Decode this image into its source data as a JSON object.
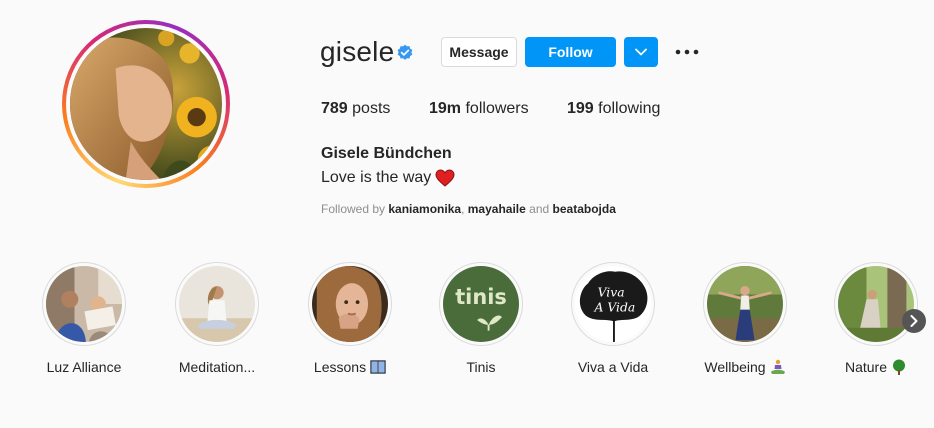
{
  "profile": {
    "username": "gisele",
    "verified": true,
    "buttons": {
      "message": "Message",
      "follow": "Follow"
    },
    "stats": {
      "posts_count": "789",
      "posts_label": "posts",
      "followers_count": "19m",
      "followers_label": "followers",
      "following_count": "199",
      "following_label": "following"
    },
    "full_name": "Gisele Bündchen",
    "bio": "Love is the way",
    "followed_by": {
      "prefix": "Followed by",
      "user1": "kaniamonika",
      "separator": ",",
      "user2": "mayahaile",
      "and": "and",
      "user3": "beatabojda"
    }
  },
  "highlights": [
    {
      "label": "Luz Alliance",
      "icon": ""
    },
    {
      "label": "Meditation...",
      "icon": ""
    },
    {
      "label": "Lessons",
      "icon": "book-icon"
    },
    {
      "label": "Tinis",
      "icon": ""
    },
    {
      "label": "Viva a Vida",
      "icon": ""
    },
    {
      "label": "Wellbeing",
      "icon": "meditating-person-icon"
    },
    {
      "label": "Nature",
      "icon": "tree-icon"
    }
  ],
  "highlight_cover_text": {
    "tinis": "tinis",
    "viva_line1": "Viva",
    "viva_line2": "A Vida"
  },
  "colors": {
    "follow_blue": "#0095f6",
    "verified_blue": "#3897f0",
    "heart_red": "#e02020",
    "tinis_green": "#4a6b3a"
  }
}
